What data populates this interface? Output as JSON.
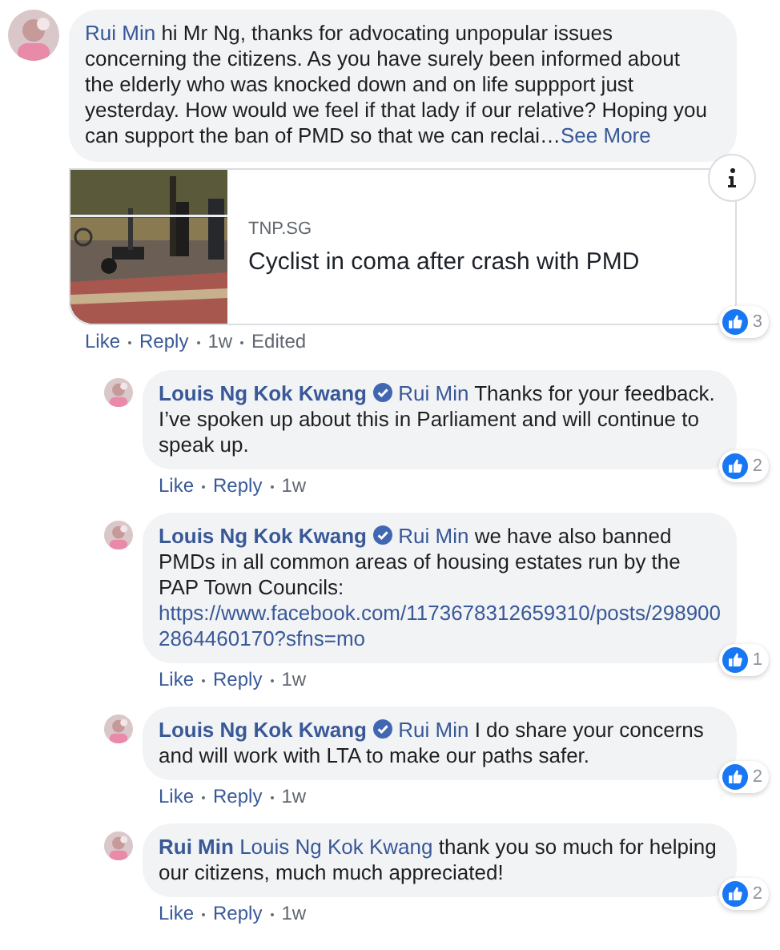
{
  "comments": [
    {
      "author": "Rui Min",
      "verified": false,
      "text": "hi Mr Ng, thanks for advocating unpopular issues concerning the citizens. As you have surely been informed about the elderly who was knocked down and on life suppport just yesterday. How would we feel if that lady if our relative? Hoping you can support the ban of PMD so that we can reclai…",
      "see_more": "See More",
      "preview": {
        "kind": "picture",
        "source": "TNP.SG",
        "title": "Cyclist in coma after crash with PMD"
      },
      "like": "Like",
      "reply": "Reply",
      "time": "1w",
      "edited": "Edited",
      "likes": "3",
      "reply_level": false
    },
    {
      "author": "Louis Ng Kok Kwang",
      "verified": true,
      "mention": "Rui Min",
      "text": "Thanks for your feedback. I’ve spoken up about this in Parliament and will continue to speak up.",
      "like": "Like",
      "reply": "Reply",
      "time": "1w",
      "likes": "2",
      "reply_level": true
    },
    {
      "author": "Louis Ng Kok Kwang",
      "verified": true,
      "mention": "Rui Min",
      "text": "we have also banned PMDs in all common areas of housing estates run by the PAP Town Councils:",
      "link": "https://www.facebook.com/1173678312659310/posts/2989002864460170?sfns=mo",
      "like": "Like",
      "reply": "Reply",
      "time": "1w",
      "likes": "1",
      "reply_level": true
    },
    {
      "author": "Louis Ng Kok Kwang",
      "verified": true,
      "mention": "Rui Min",
      "text": "I do share your concerns and will work with LTA to make our paths safer.",
      "like": "Like",
      "reply": "Reply",
      "time": "1w",
      "likes": "2",
      "reply_level": true
    },
    {
      "author": "Rui Min",
      "verified": false,
      "mention": "Louis Ng Kok Kwang",
      "text": "thank you so much for helping our citizens, much much appreciated!",
      "like": "Like",
      "reply": "Reply",
      "time": "1w",
      "likes": "2",
      "reply_level": true
    }
  ]
}
